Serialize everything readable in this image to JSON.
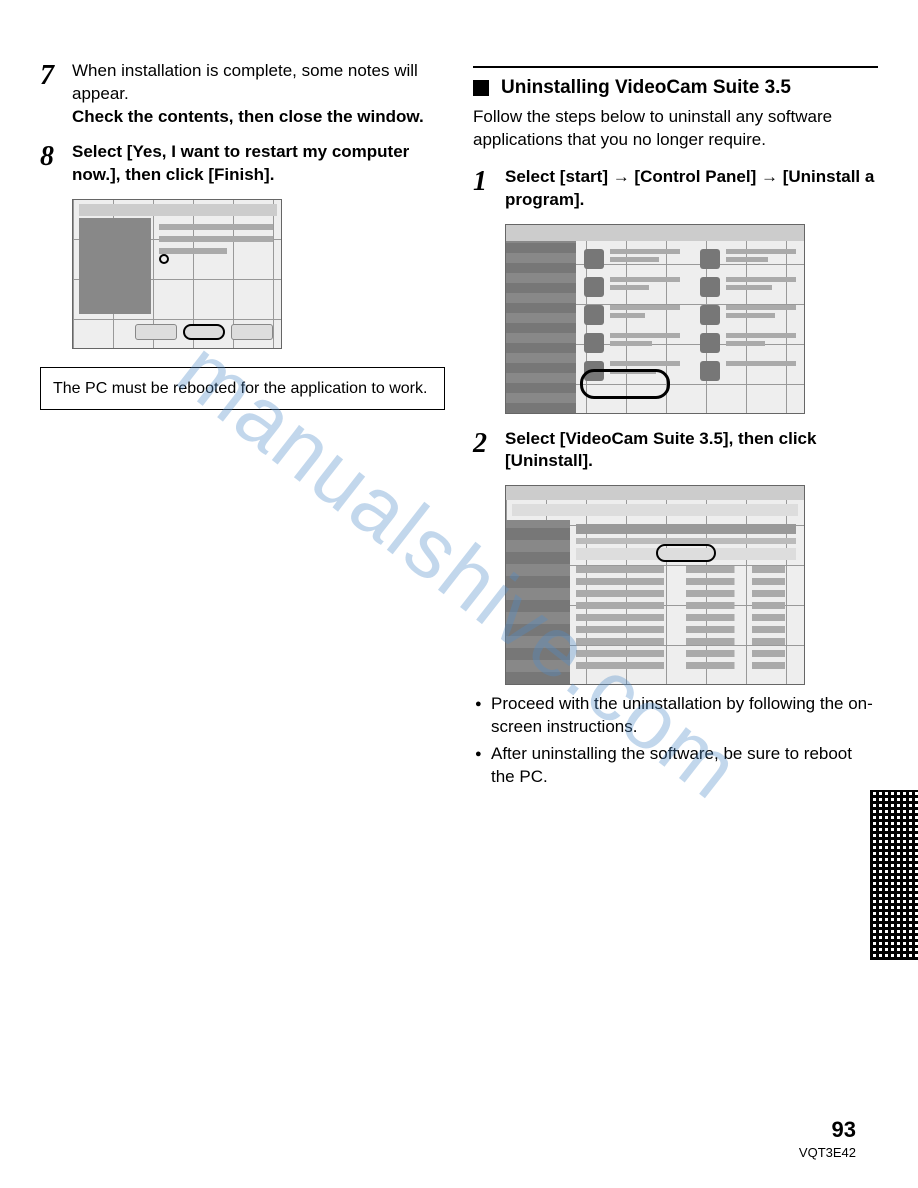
{
  "left": {
    "step7": {
      "num": "7",
      "line1": "When installation is complete, some notes will appear.",
      "line2": "Check the contents, then close the window."
    },
    "step8": {
      "num": "8",
      "line1": "Select [Yes, I want to restart my computer now.], then click [Finish]."
    },
    "note": "The PC must be rebooted for the application to work."
  },
  "right": {
    "section_title": "Uninstalling VideoCam Suite 3.5",
    "section_sub": "Follow the steps below to uninstall any software applications that you no longer require.",
    "step1": {
      "num": "1",
      "text_a": "Select [start] ",
      "text_b": " [Control Panel] ",
      "text_c": " [Uninstall a program]."
    },
    "step2": {
      "num": "2",
      "text": "Select [VideoCam Suite 3.5], then click [Uninstall]."
    },
    "bullets": [
      "Proceed with the uninstallation by following the on-screen instructions.",
      "After uninstalling the software, be sure to reboot the PC."
    ]
  },
  "watermark": "manualshive.com",
  "footer": {
    "page": "93",
    "code": "VQT3E42"
  }
}
